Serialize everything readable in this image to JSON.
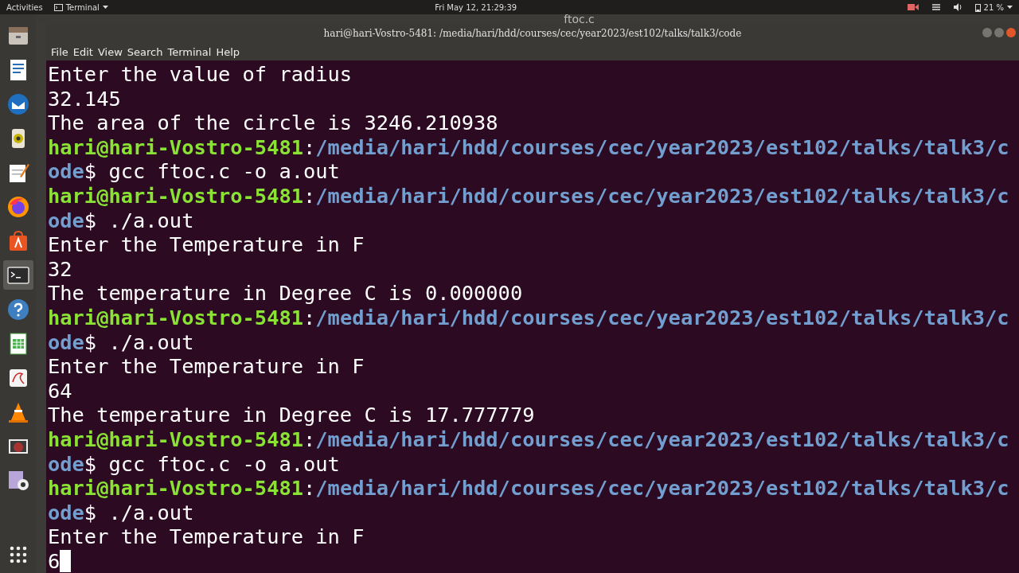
{
  "top_bar": {
    "activities": "Activities",
    "app_menu": "Terminal",
    "clock": "Fri May 12, 21:29:39",
    "battery": "21 %"
  },
  "dock": [
    {
      "kind": "files",
      "selected": false
    },
    {
      "kind": "writer",
      "selected": false
    },
    {
      "kind": "mail",
      "selected": false
    },
    {
      "kind": "speaker",
      "selected": false
    },
    {
      "kind": "editor",
      "selected": false
    },
    {
      "kind": "firefox",
      "selected": false
    },
    {
      "kind": "store",
      "selected": false
    },
    {
      "kind": "terminal",
      "selected": true
    },
    {
      "kind": "help",
      "selected": false
    },
    {
      "kind": "calc",
      "selected": false
    },
    {
      "kind": "pdf",
      "selected": false
    },
    {
      "kind": "vlc",
      "selected": false
    },
    {
      "kind": "recorder",
      "selected": false
    },
    {
      "kind": "webcam",
      "selected": false
    }
  ],
  "background_window": {
    "title": "ftoc.c"
  },
  "window": {
    "title": "hari@hari-Vostro-5481: /media/hari/hdd/courses/cec/year2023/est102/talks/talk3/code",
    "menu": [
      "File",
      "Edit",
      "View",
      "Search",
      "Terminal",
      "Help"
    ]
  },
  "terminal": {
    "rows": [
      [
        {
          "kind": "output",
          "text": "Enter the value of radius"
        }
      ],
      [
        {
          "kind": "output",
          "text": "32.145"
        }
      ],
      [
        {
          "kind": "output",
          "text": "The area of the circle is 3246.210938"
        }
      ],
      [
        {
          "kind": "user",
          "text": "hari@hari-Vostro-5481"
        },
        {
          "kind": "output",
          "text": ":"
        },
        {
          "kind": "path",
          "text": "/media/hari/hdd/courses/cec/year2023/est102/talks/talk3/c"
        }
      ],
      [
        {
          "kind": "path",
          "text": "ode"
        },
        {
          "kind": "output",
          "text": "$ gcc ftoc.c -o a.out"
        }
      ],
      [
        {
          "kind": "user",
          "text": "hari@hari-Vostro-5481"
        },
        {
          "kind": "output",
          "text": ":"
        },
        {
          "kind": "path",
          "text": "/media/hari/hdd/courses/cec/year2023/est102/talks/talk3/c"
        }
      ],
      [
        {
          "kind": "path",
          "text": "ode"
        },
        {
          "kind": "output",
          "text": "$ ./a.out"
        }
      ],
      [
        {
          "kind": "output",
          "text": "Enter the Temperature in F"
        }
      ],
      [
        {
          "kind": "output",
          "text": "32"
        }
      ],
      [
        {
          "kind": "output",
          "text": "The temperature in Degree C is 0.000000"
        }
      ],
      [
        {
          "kind": "user",
          "text": "hari@hari-Vostro-5481"
        },
        {
          "kind": "output",
          "text": ":"
        },
        {
          "kind": "path",
          "text": "/media/hari/hdd/courses/cec/year2023/est102/talks/talk3/c"
        }
      ],
      [
        {
          "kind": "path",
          "text": "ode"
        },
        {
          "kind": "output",
          "text": "$ ./a.out"
        }
      ],
      [
        {
          "kind": "output",
          "text": "Enter the Temperature in F"
        }
      ],
      [
        {
          "kind": "output",
          "text": "64"
        }
      ],
      [
        {
          "kind": "output",
          "text": "The temperature in Degree C is 17.777779"
        }
      ],
      [
        {
          "kind": "user",
          "text": "hari@hari-Vostro-5481"
        },
        {
          "kind": "output",
          "text": ":"
        },
        {
          "kind": "path",
          "text": "/media/hari/hdd/courses/cec/year2023/est102/talks/talk3/c"
        }
      ],
      [
        {
          "kind": "path",
          "text": "ode"
        },
        {
          "kind": "output",
          "text": "$ gcc ftoc.c -o a.out"
        }
      ],
      [
        {
          "kind": "user",
          "text": "hari@hari-Vostro-5481"
        },
        {
          "kind": "output",
          "text": ":"
        },
        {
          "kind": "path",
          "text": "/media/hari/hdd/courses/cec/year2023/est102/talks/talk3/c"
        }
      ],
      [
        {
          "kind": "path",
          "text": "ode"
        },
        {
          "kind": "output",
          "text": "$ ./a.out"
        }
      ],
      [
        {
          "kind": "output",
          "text": "Enter the Temperature in F"
        }
      ],
      [
        {
          "kind": "output",
          "text": "6"
        }
      ]
    ],
    "cursor": true
  }
}
